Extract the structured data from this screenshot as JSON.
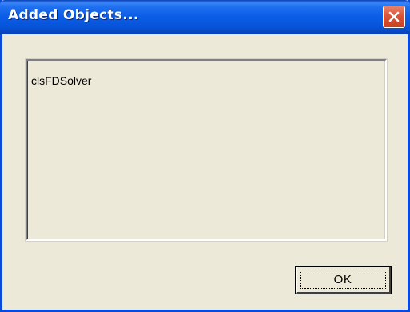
{
  "window": {
    "title": "Added Objects..."
  },
  "titlebar": {
    "close_icon": "close-icon"
  },
  "objects_list": {
    "items": [
      "clsFDSolver"
    ]
  },
  "buttons": {
    "ok_label": "OK"
  },
  "colors": {
    "titlebar_blue": "#0a5ce6",
    "close_red": "#d9553a",
    "dialog_background": "#ece9d8"
  }
}
